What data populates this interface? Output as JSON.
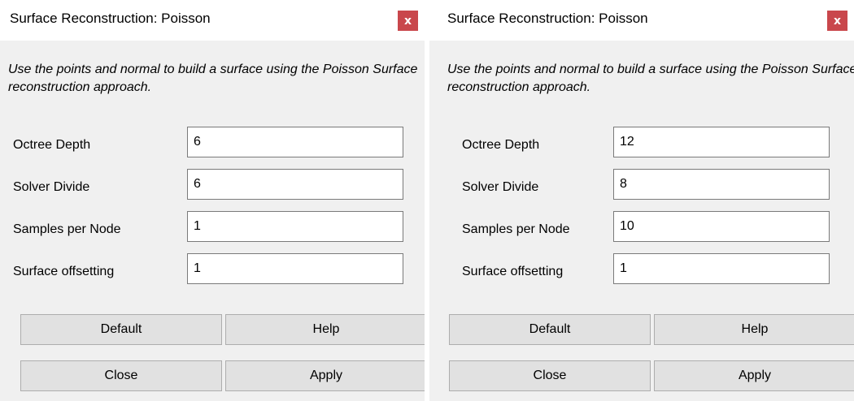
{
  "dialogs": [
    {
      "title": "Surface Reconstruction: Poisson",
      "close_label": "x",
      "description": "Use the points and normal to build a surface using the Poisson Surface reconstruction approach.",
      "params": [
        {
          "label": "Octree Depth",
          "value": "6"
        },
        {
          "label": "Solver Divide",
          "value": "6"
        },
        {
          "label": "Samples per Node",
          "value": "1"
        },
        {
          "label": "Surface offsetting",
          "value": "1"
        }
      ],
      "buttons": {
        "default": "Default",
        "help": "Help",
        "close": "Close",
        "apply": "Apply"
      }
    },
    {
      "title": "Surface Reconstruction: Poisson",
      "close_label": "x",
      "description": "Use the points and normal to build a surface using the Poisson Surface reconstruction approach.",
      "params": [
        {
          "label": "Octree Depth",
          "value": "12"
        },
        {
          "label": "Solver Divide",
          "value": "8"
        },
        {
          "label": "Samples per Node",
          "value": "10"
        },
        {
          "label": "Surface offsetting",
          "value": "1"
        }
      ],
      "buttons": {
        "default": "Default",
        "help": "Help",
        "close": "Close",
        "apply": "Apply"
      }
    }
  ],
  "colors": {
    "close_button": "#c9474c",
    "dialog_bg": "#f0f0f0",
    "button_bg": "#e1e1e1"
  }
}
